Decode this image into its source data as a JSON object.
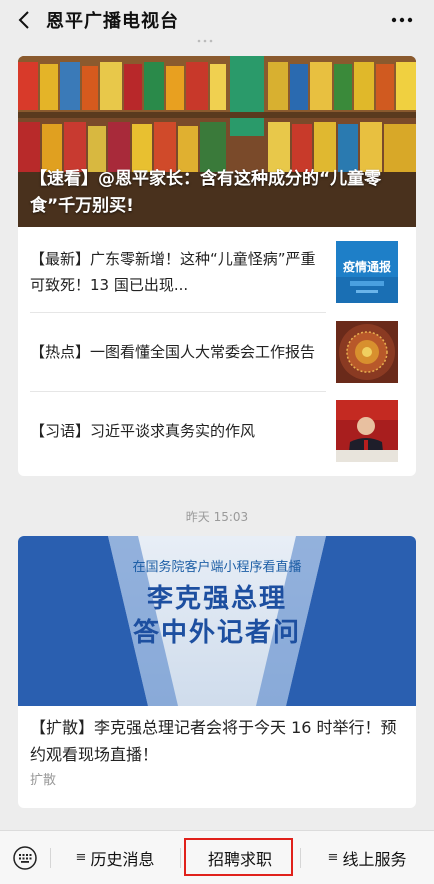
{
  "header": {
    "title": "恩平广播电视台",
    "back_icon": "back-icon",
    "more_icon": "more-icon"
  },
  "article_group_1": {
    "main": {
      "title": "【速看】@恩平家长：含有这种成分的“儿童零食”千万别买!"
    },
    "items": [
      {
        "title": "【最新】广东零新增！这种“儿童怪病”严重可致死！13 国已出现...",
        "thumb_caption": "疫情通报"
      },
      {
        "title": "【热点】一图看懂全国人大常委会工作报告"
      },
      {
        "title": "【习语】习近平谈求真务实的作风"
      }
    ]
  },
  "timestamp": "昨天 15:03",
  "article_group_2": {
    "banner_sub": "在国务院客户端小程序看直播",
    "banner_line1": "李克强总理",
    "banner_line2": "答中外记者问",
    "title": "【扩散】李克强总理记者会将于今天 16 时举行！预约观看现场直播！",
    "source": "扩散"
  },
  "bottom_menu": {
    "keyboard_icon": "keyboard-icon",
    "items": [
      {
        "label": "历史消息",
        "icon": "menu-icon"
      },
      {
        "label": "招聘求职"
      },
      {
        "label": "线上服务",
        "icon": "menu-icon"
      }
    ],
    "highlight_color": "#e0211b"
  }
}
